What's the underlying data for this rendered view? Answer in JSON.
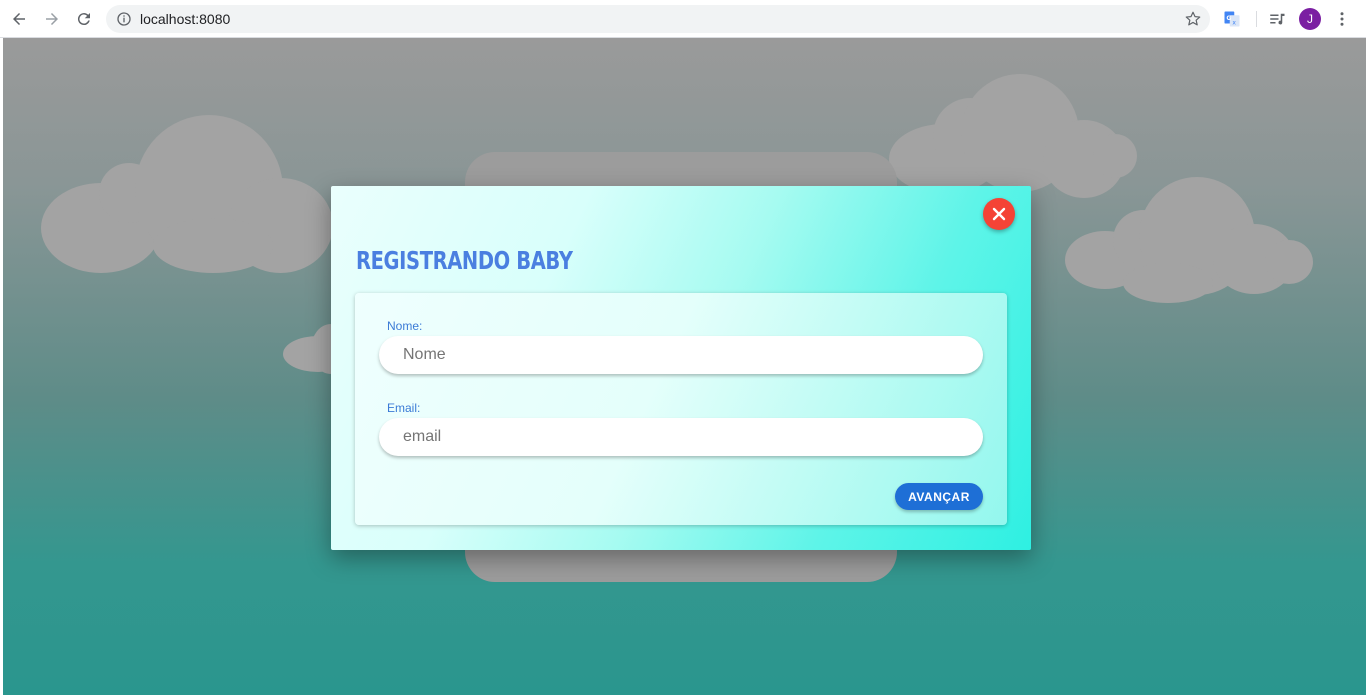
{
  "browser": {
    "url": "localhost:8080",
    "profile_initial": "J",
    "icons": {
      "back": "arrow-left-icon",
      "forward": "arrow-right-icon",
      "reload": "reload-icon",
      "info": "info-icon",
      "bookmark": "star-icon",
      "translate": "google-translate-icon",
      "media": "playlist-icon",
      "menu": "kebab-menu-icon"
    }
  },
  "modal": {
    "title": "Registrando Baby",
    "close_icon": "close-icon",
    "form": {
      "name": {
        "label": "Nome:",
        "placeholder": "Nome",
        "value": ""
      },
      "email": {
        "label": "Email:",
        "placeholder": "email",
        "value": ""
      },
      "submit_label": "AVANÇAR"
    }
  },
  "colors": {
    "title": "#4a7fe0",
    "label": "#3b7bd6",
    "button": "#1e6fd6",
    "close": "#f44336",
    "avatar": "#7b1fa2"
  }
}
